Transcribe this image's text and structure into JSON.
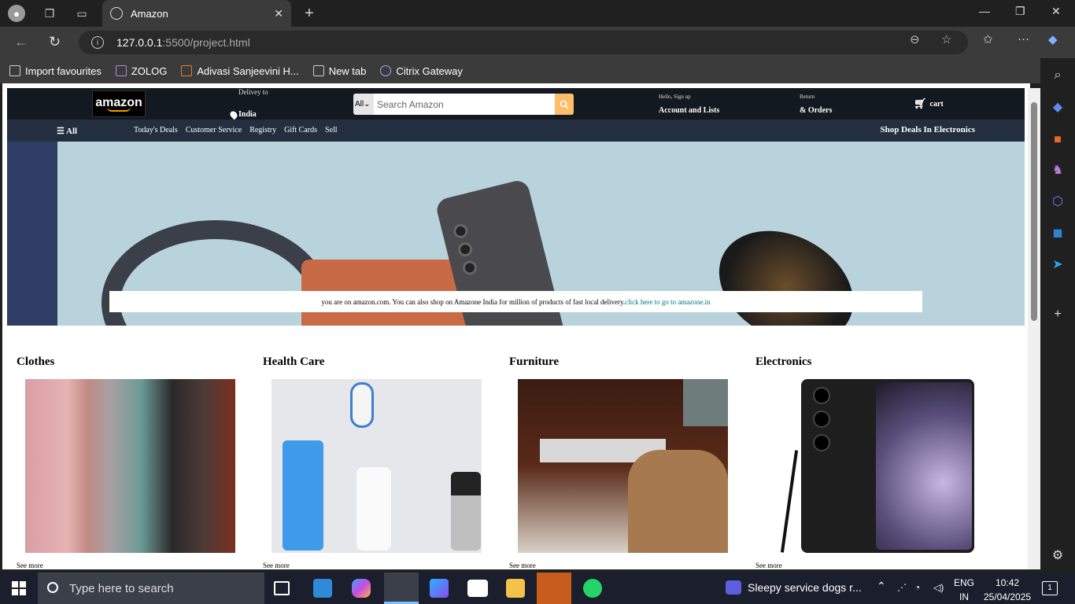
{
  "browser": {
    "tab_title": "Amazon",
    "url_host": "127.0.0.1",
    "url_path": ":5500/project.html",
    "bookmarks": [
      "Import favourites",
      "ZOLOG",
      "Adivasi Sanjeevini H...",
      "New tab",
      "Citrix Gateway"
    ]
  },
  "nav": {
    "logo_text": "amazon",
    "deliver_to": "Delivey to",
    "country": "India",
    "search_category": "All",
    "search_placeholder": "Search Amazon",
    "hello": "Hello, Sign up",
    "account": "Account and Lists",
    "return": "Return",
    "orders": "& Orders",
    "cart": "cart"
  },
  "subnav": {
    "all": "All",
    "links": [
      "Today's Deals",
      "Customer Service",
      "Registry",
      "Gift Cards",
      "Sell"
    ],
    "deals": "Shop Deals In Electronics"
  },
  "banner": {
    "text": "you are on amazon.com. You can also shop on Amazone India for million of products of fast local delivery.",
    "link": "click here to go to amazone.in"
  },
  "categories": [
    {
      "title": "Clothes",
      "see_more": "See more"
    },
    {
      "title": "Health Care",
      "see_more": "See more"
    },
    {
      "title": "Furniture",
      "see_more": "See more"
    },
    {
      "title": "Electronics",
      "see_more": "See more"
    }
  ],
  "taskbar": {
    "search_placeholder": "Type here to search",
    "now_playing": "Sleepy service dogs r...",
    "lang_top": "ENG",
    "lang_bottom": "IN",
    "time": "10:42",
    "date": "25/04/2025",
    "notifications": "1"
  },
  "colors": {
    "amazon_dark": "#131921",
    "amazon_nav": "#232f3e",
    "search_button": "#febd69",
    "link": "#007185"
  }
}
